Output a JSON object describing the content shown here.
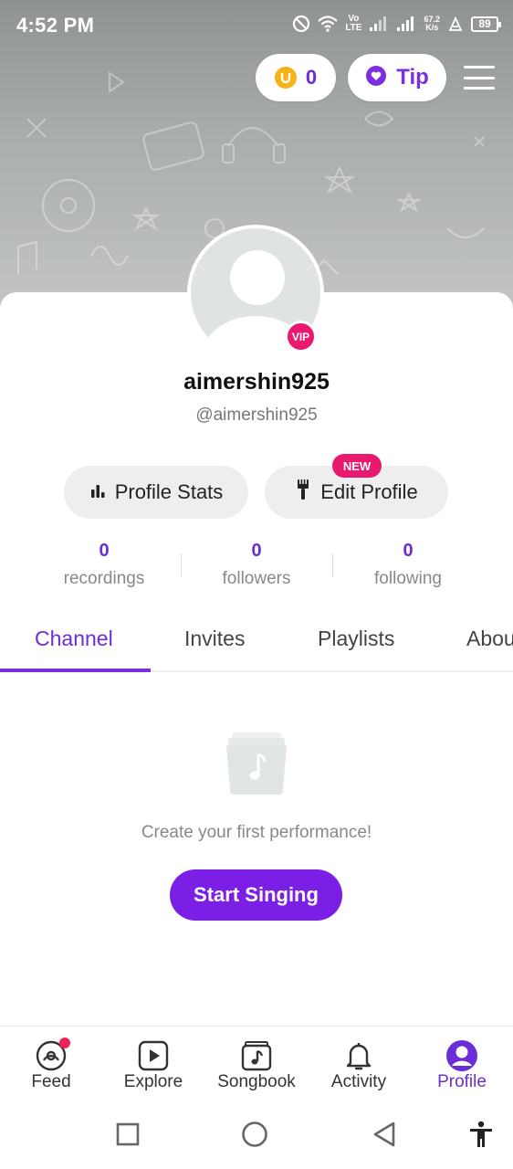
{
  "status_bar": {
    "time": "4:52 PM",
    "net_speed_value": "67.2",
    "net_speed_unit": "K/s",
    "network_label_top": "Vo",
    "network_label_bottom": "LTE",
    "battery": "89",
    "icons": [
      "dnd-icon",
      "wifi-icon",
      "signal-icon",
      "signal-icon",
      "alarm-icon",
      "battery-icon"
    ]
  },
  "top_actions": {
    "coins": "0",
    "tip_label": "Tip"
  },
  "profile": {
    "username": "aimershin925",
    "handle": "@aimershin925",
    "vip_badge": "VIP"
  },
  "buttons": {
    "profile_stats": "Profile Stats",
    "edit_profile": "Edit Profile",
    "new_badge": "NEW"
  },
  "stats": [
    {
      "value": "0",
      "label": "recordings"
    },
    {
      "value": "0",
      "label": "followers"
    },
    {
      "value": "0",
      "label": "following"
    }
  ],
  "tabs": [
    {
      "label": "Channel",
      "active": true
    },
    {
      "label": "Invites",
      "active": false
    },
    {
      "label": "Playlists",
      "active": false
    },
    {
      "label": "About",
      "active": false
    }
  ],
  "empty_state": {
    "message": "Create your first performance!",
    "cta": "Start Singing"
  },
  "bottom_nav": [
    {
      "label": "Feed",
      "icon": "feed-icon",
      "active": false,
      "notification_dot": true
    },
    {
      "label": "Explore",
      "icon": "explore-icon",
      "active": false
    },
    {
      "label": "Songbook",
      "icon": "songbook-icon",
      "active": false
    },
    {
      "label": "Activity",
      "icon": "bell-icon",
      "active": false
    },
    {
      "label": "Profile",
      "icon": "profile-icon",
      "active": true
    }
  ],
  "colors": {
    "accent": "#7b1fe6",
    "accent_text": "#6a2dd6",
    "badge_pink": "#e8196e",
    "coin": "#f4b316"
  }
}
